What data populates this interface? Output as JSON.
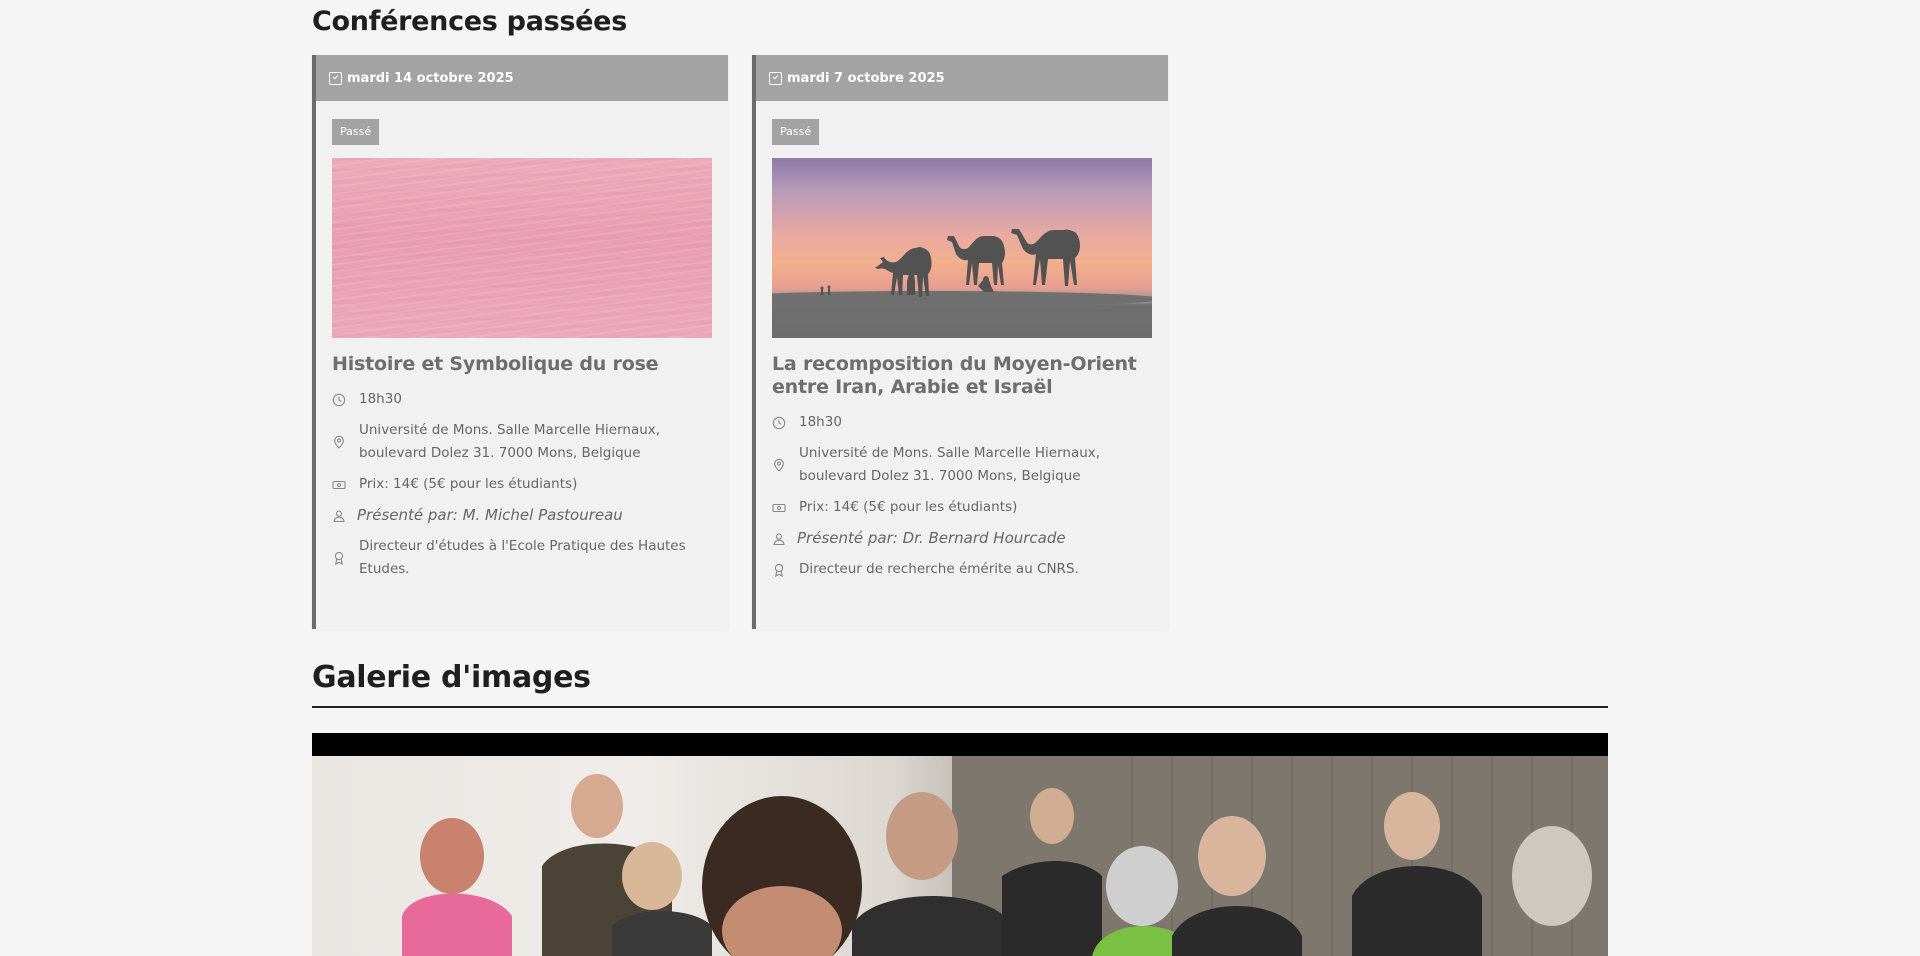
{
  "sections": {
    "past_conferences_title": "Conférences passées",
    "gallery_title": "Galerie d'images"
  },
  "cards": [
    {
      "date": "mardi 14 octobre 2025",
      "badge": "Passé",
      "title": "Histoire et Symbolique du rose",
      "time": "18h30",
      "location": "Université de Mons. Salle Marcelle Hiernaux, boulevard Dolez 31. 7000 Mons, Belgique",
      "price": "Prix: 14€ (5€ pour les étudiants)",
      "presenter": "Présenté par: M. Michel Pastoureau",
      "role": "Directeur d'études à l'Ecole Pratique des Hautes Etudes."
    },
    {
      "date": "mardi 7 octobre 2025",
      "badge": "Passé",
      "title": "La recomposition du Moyen-Orient entre Iran, Arabie et Israël",
      "time": "18h30",
      "location": "Université de Mons. Salle Marcelle Hiernaux, boulevard Dolez 31. 7000 Mons, Belgique",
      "price": "Prix: 14€ (5€ pour les étudiants)",
      "presenter": "Présenté par: Dr. Bernard Hourcade",
      "role": "Directeur de recherche émérite au CNRS."
    }
  ],
  "icons": {
    "date": "calendar-icon",
    "time": "clock-icon",
    "location": "map-pin-icon",
    "price": "ticket-icon",
    "presenter": "user-icon",
    "role": "award-icon"
  },
  "colors": {
    "card_header": "#a3a3a3",
    "card_border": "#6b6b6b",
    "background": "#f5f5f5"
  }
}
